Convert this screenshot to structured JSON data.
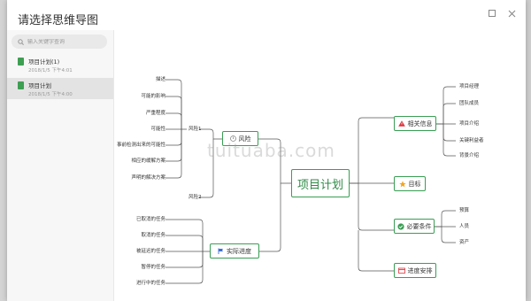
{
  "dialog": {
    "title": "请选择思维导图"
  },
  "search": {
    "placeholder": "输入关键字查询"
  },
  "files": [
    {
      "name": "项目计划(1)",
      "date": "2018/1/5  下午4:01"
    },
    {
      "name": "项目计划",
      "date": "2018/1/5  下午4:00"
    }
  ],
  "watermark": "tuituaba.com",
  "mindmap": {
    "central": "项目计划",
    "risk": {
      "label": "风险",
      "sub1": "风险1",
      "sub2": "风险2",
      "leaves": [
        "描述",
        "可能的影响",
        "严重程度",
        "可能性",
        "事前检测出来的可能性",
        "相应的缓解方案",
        "声明的解决方案"
      ]
    },
    "progress": {
      "label": "实际进度",
      "leaves": [
        "已取消的任务",
        "取消的任务",
        "被延迟的任务",
        "暂停的任务",
        "进行中的任务"
      ]
    },
    "info": {
      "label": "相关信息",
      "leaves": [
        "项目经理",
        "团队成员",
        "项目介绍",
        "关键利益者",
        "背景介绍"
      ]
    },
    "goal": {
      "label": "目标"
    },
    "conditions": {
      "label": "必要条件",
      "leaves": [
        "预算",
        "人员",
        "资产"
      ]
    },
    "schedule": {
      "label": "进度安排"
    }
  },
  "colors": {
    "accent": "#3a9e54",
    "file_icon": "#3d9f52",
    "info_icon": "#d9363e",
    "goal_icon": "#f2a51c",
    "progress_icon": "#3b6fd6"
  }
}
